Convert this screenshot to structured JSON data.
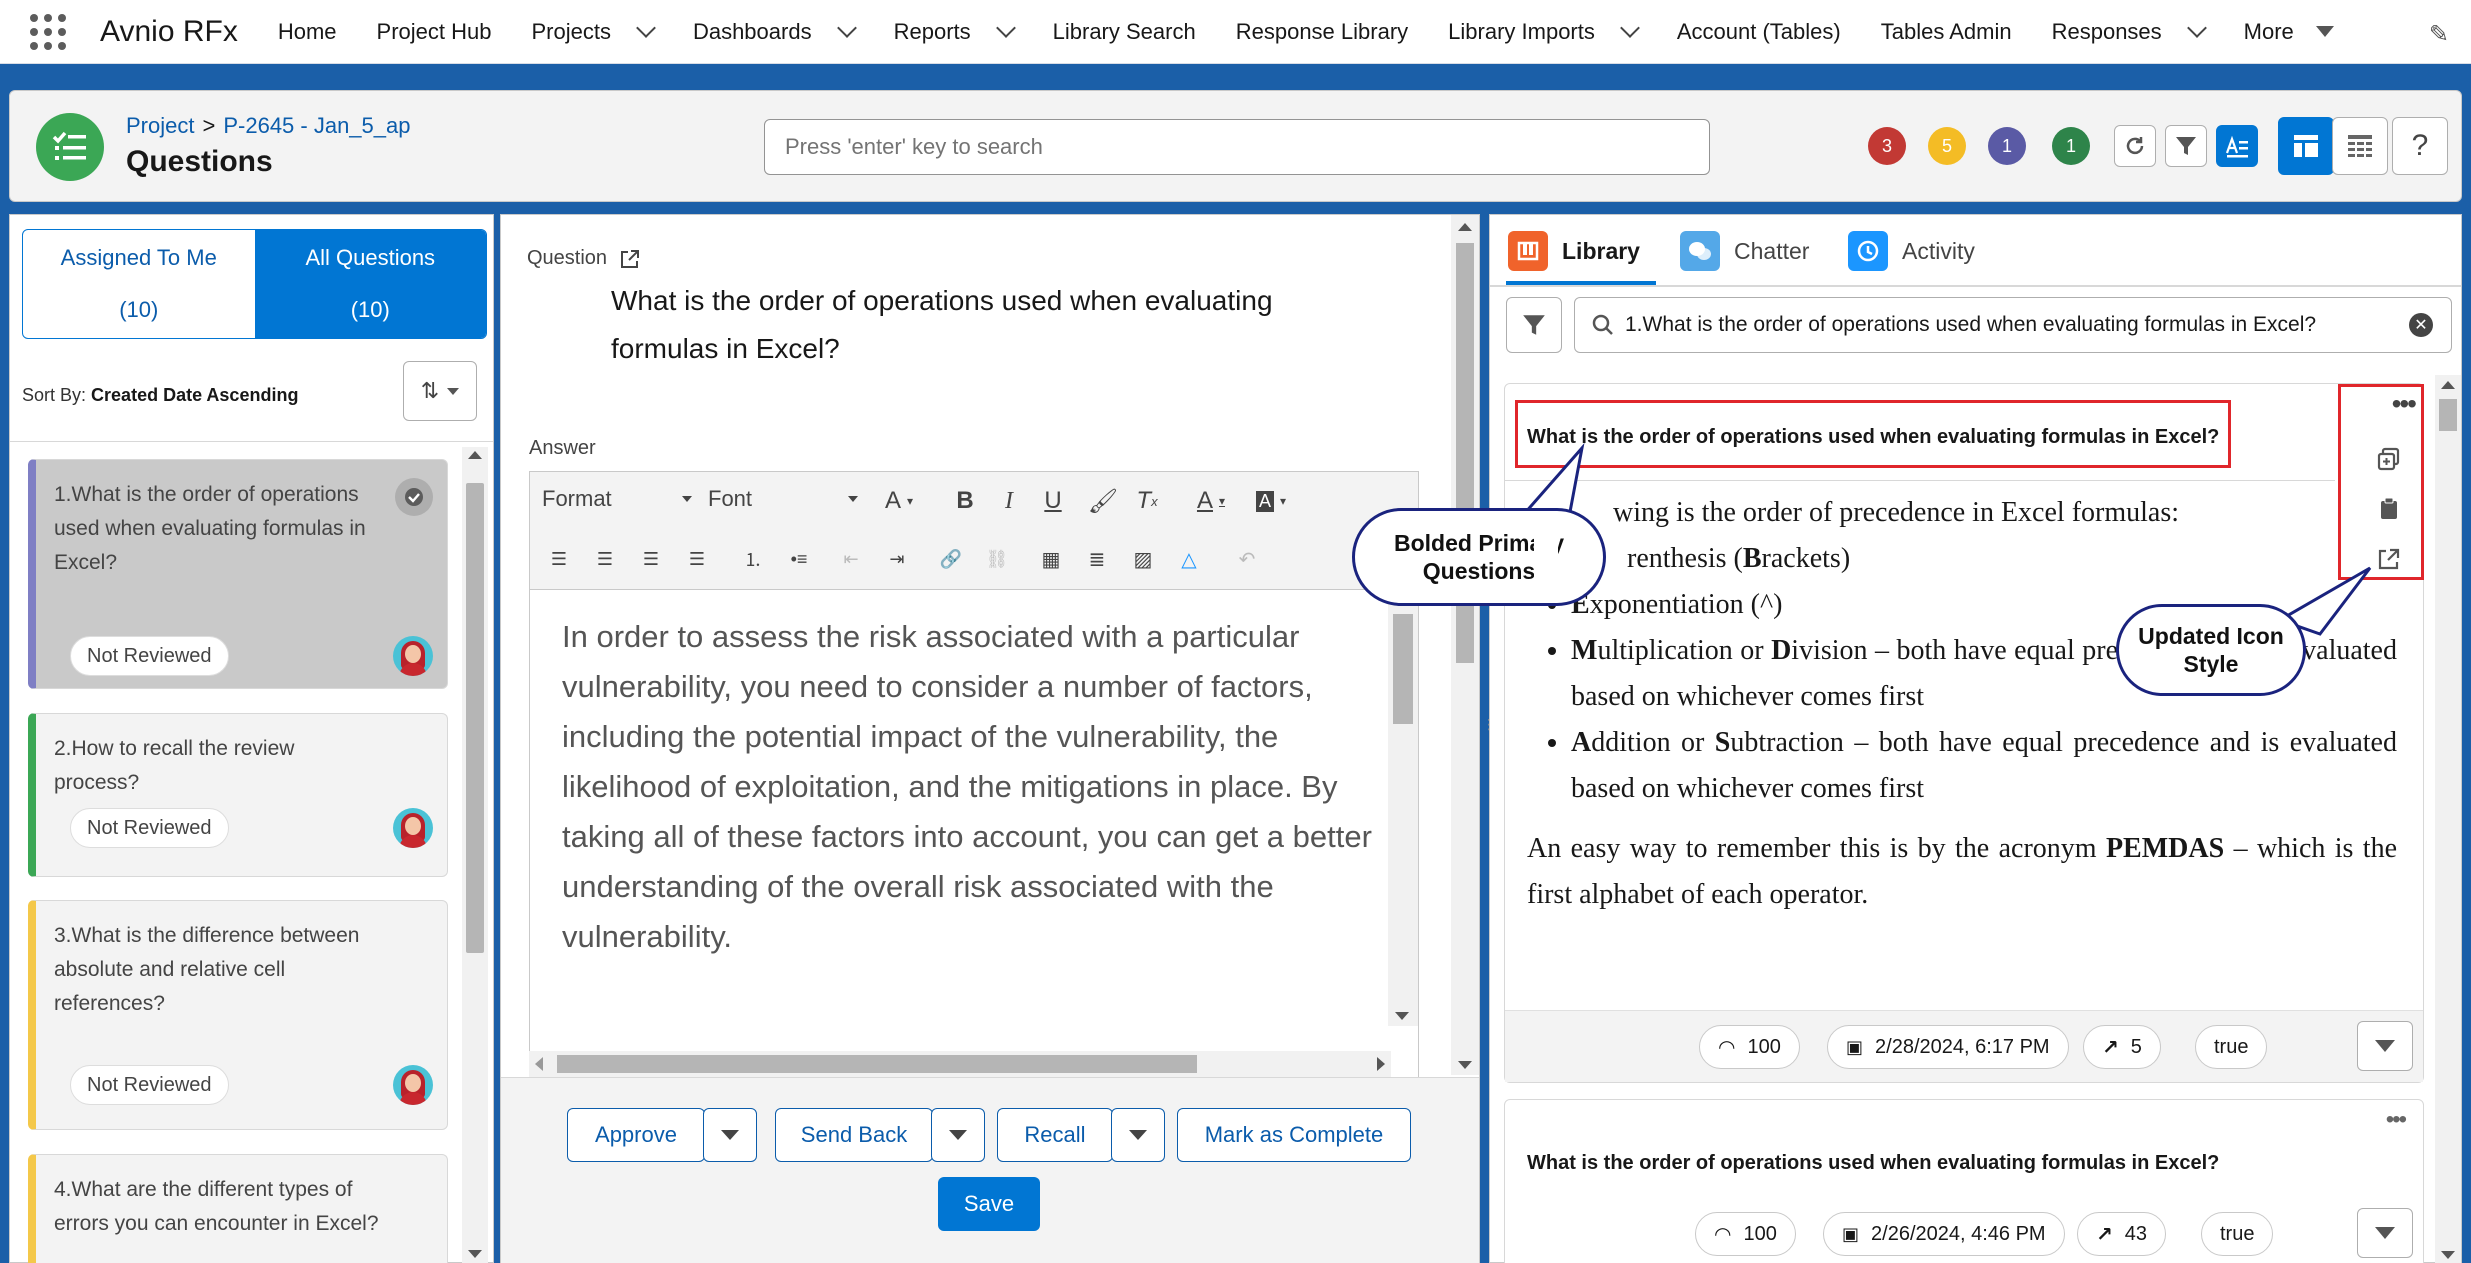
{
  "nav": {
    "app_name": "Avnio RFx",
    "items": [
      {
        "label": "Home",
        "dropdown": false
      },
      {
        "label": "Project Hub",
        "dropdown": false
      },
      {
        "label": "Projects",
        "dropdown": true
      },
      {
        "label": "Dashboards",
        "dropdown": true
      },
      {
        "label": "Reports",
        "dropdown": true
      },
      {
        "label": "Library Search",
        "dropdown": false
      },
      {
        "label": "Response Library",
        "dropdown": false
      },
      {
        "label": "Library Imports",
        "dropdown": true
      },
      {
        "label": "Account (Tables)",
        "dropdown": false
      },
      {
        "label": "Tables Admin",
        "dropdown": false
      },
      {
        "label": "Responses",
        "dropdown": true
      },
      {
        "label": "More",
        "dropdown": true
      }
    ]
  },
  "header": {
    "breadcrumb_root": "Project",
    "breadcrumb_sep": ">",
    "breadcrumb_current": "P-2645 - Jan_5_ap",
    "title": "Questions",
    "search_placeholder": "Press 'enter' key to search",
    "badges": [
      {
        "count": "3",
        "color": "#c23934"
      },
      {
        "count": "5",
        "color": "#f4bc25"
      },
      {
        "count": "1",
        "color": "#5a5aa5"
      },
      {
        "count": "1",
        "color": "#2e844a"
      }
    ]
  },
  "left": {
    "tabs": [
      {
        "label": "Assigned To Me",
        "count": "(10)"
      },
      {
        "label": "All Questions",
        "count": "(10)"
      }
    ],
    "sort_prefix": "Sort By:",
    "sort_value": "Created Date Ascending",
    "questions": [
      {
        "text": "1.What is the order of operations used when evaluating formulas in Excel?",
        "status": "Not Reviewed",
        "border": "#7f7fc4"
      },
      {
        "text": "2.How to recall the review process?",
        "status": "Not Reviewed",
        "border": "#3ba755"
      },
      {
        "text": "3.What is the difference between absolute and relative cell references?",
        "status": "Not Reviewed",
        "border": "#f4c84a"
      },
      {
        "text": "4.What are the different types of errors you can encounter in Excel?",
        "status": "",
        "border": "#f4c84a"
      }
    ]
  },
  "middle": {
    "question_label": "Question",
    "question_text": "What is the order of operations used when evaluating formulas in Excel?",
    "answer_label": "Answer",
    "toolbar": {
      "format": "Format",
      "font": "Font"
    },
    "answer_text": "In order to assess the risk associated with a particular vulnerability, you need to consider a number of factors, including the potential impact of the vulnerability, the likelihood of exploitation, and the mitigations in place. By taking all of these factors into account, you can get a better understanding of the overall risk associated with the vulnerability.",
    "buttons": {
      "approve": "Approve",
      "send_back": "Send Back",
      "recall": "Recall",
      "complete": "Mark as Complete",
      "save": "Save"
    }
  },
  "right": {
    "tabs": [
      "Library",
      "Chatter",
      "Activity"
    ],
    "search_value": "1.What is the order of operations used when evaluating formulas in Excel?",
    "results": [
      {
        "title": "What is the order of operations used when evaluating formulas in Excel?",
        "intro": "wing is the order of precedence in Excel formulas:",
        "items": [
          {
            "lead": "",
            "text": "renthesis (",
            "bold": "B",
            "tail": "rackets)"
          },
          {
            "lead": "E",
            "text": "xponentiation (^)"
          },
          {
            "lead": "M",
            "text": "ultiplication or ",
            "bold": "D",
            "tail": "ivision – both have equal precedence and is evaluated based on whichever comes first"
          },
          {
            "lead": "A",
            "text": "ddition or ",
            "bold": "S",
            "tail": "ubtraction – both have equal precedence and is evaluated based on whichever comes first"
          }
        ],
        "outro_pre": "An easy way to remember this is by the acronym ",
        "outro_bold": "PEMDAS",
        "outro_post": " – which is the first alphabet of each operator.",
        "views": "100",
        "date": "2/28/2024, 6:17 PM",
        "usage": "5",
        "flag": "true"
      },
      {
        "title": "What is the order of operations used when evaluating formulas in Excel?",
        "views": "100",
        "date": "2/26/2024, 4:46 PM",
        "usage": "43",
        "flag": "true"
      }
    ]
  },
  "callouts": {
    "bolded": "Bolded Primary Questions",
    "icons": "Updated Icon Style"
  }
}
